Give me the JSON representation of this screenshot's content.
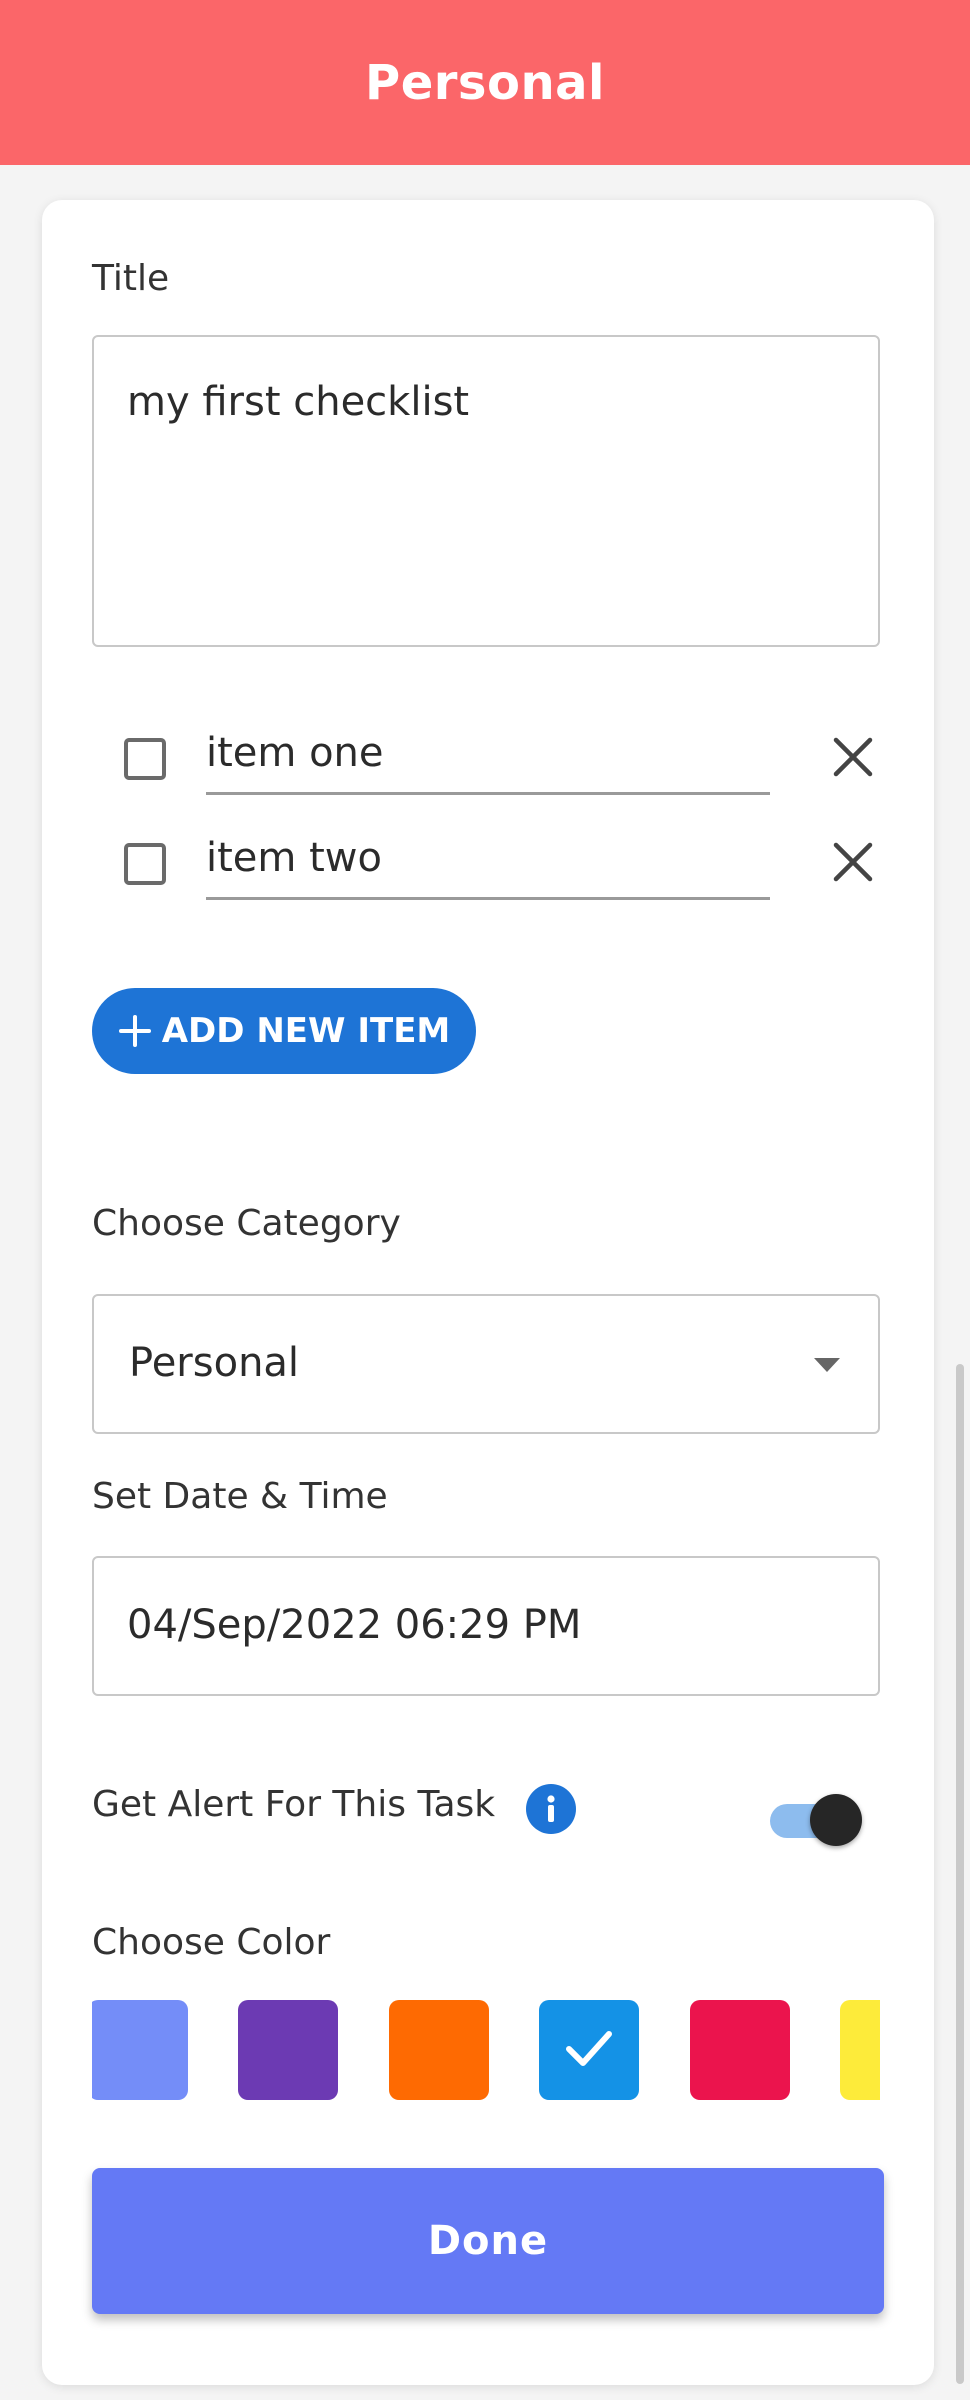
{
  "header": {
    "title": "Personal"
  },
  "form": {
    "title_label": "Title",
    "title_value": "my first checklist",
    "items": [
      {
        "text": "item one",
        "checked": false
      },
      {
        "text": "item two",
        "checked": false
      }
    ],
    "add_item_label": "ADD NEW ITEM",
    "category_label": "Choose Category",
    "category_value": "Personal",
    "datetime_label": "Set Date & Time",
    "datetime_value": "04/Sep/2022 06:29 PM",
    "alert_label": "Get Alert For This Task",
    "alert_enabled": true,
    "color_label": "Choose Color",
    "colors": [
      "#748df8",
      "#6c3ab3",
      "#fe6a02",
      "#1492e6",
      "#eb144d",
      "#fdeb3a"
    ],
    "selected_color_index": 3,
    "done_label": "Done"
  },
  "icons": {
    "add": "plus-icon",
    "remove": "close-icon",
    "caret": "caret-down-icon",
    "info": "info-icon",
    "selected": "check-icon"
  }
}
